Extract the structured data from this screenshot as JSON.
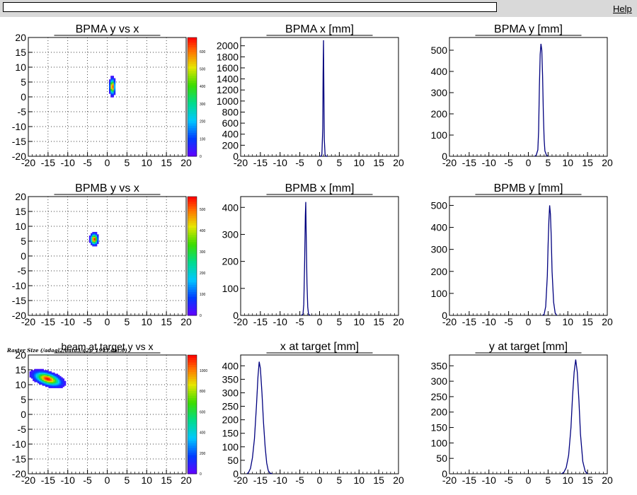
{
  "window": {
    "help_label": "Help",
    "canvas_caption": "Raster Size (/adaql2/data3/g2p_1943.dat.0)"
  },
  "colors": {
    "histogram_line": "#00007f",
    "background": "#ffffff",
    "grid": "#000000"
  },
  "chart_data": [
    {
      "type": "heatmap",
      "title": "BPMA y vs x",
      "xlim": [
        -20,
        20
      ],
      "ylim": [
        -20,
        20
      ],
      "xticks": [
        "-20",
        "-15",
        "-10",
        "-5",
        "0",
        "5",
        "10",
        "15",
        "20"
      ],
      "yticks": [
        "20",
        "15",
        "10",
        "5",
        "0",
        "-5",
        "-10",
        "-15",
        "-20"
      ],
      "grid": true,
      "hotspot": {
        "x": 1.1,
        "y": 3.3,
        "sx": 0.35,
        "sy": 1.4,
        "peak": 680
      },
      "palette_ticks": [
        "600",
        "500",
        "400",
        "300",
        "200",
        "100",
        "0"
      ],
      "zmax": 680
    },
    {
      "type": "histogram",
      "title": "BPMA x [mm]",
      "xlim": [
        -20,
        20
      ],
      "ylim": [
        0,
        2150
      ],
      "xticks": [
        "-20",
        "-15",
        "-10",
        "-5",
        "0",
        "5",
        "10",
        "15",
        "20"
      ],
      "yticks": [
        "2000",
        "1800",
        "1600",
        "1400",
        "1200",
        "1000",
        "800",
        "600",
        "400",
        "200",
        "0"
      ],
      "ytick_values": [
        2000,
        1800,
        1600,
        1400,
        1200,
        1000,
        800,
        600,
        400,
        200,
        0
      ],
      "x": [
        0.0,
        0.4,
        0.6,
        0.8,
        0.9,
        1.0,
        1.1,
        1.2,
        1.4,
        1.6,
        2.0
      ],
      "y": [
        0,
        0,
        40,
        500,
        1500,
        2100,
        1200,
        300,
        30,
        0,
        0
      ]
    },
    {
      "type": "histogram",
      "title": "BPMA y [mm]",
      "xlim": [
        -20,
        20
      ],
      "ylim": [
        0,
        560
      ],
      "xticks": [
        "-20",
        "-15",
        "-10",
        "-5",
        "0",
        "5",
        "10",
        "15",
        "20"
      ],
      "yticks": [
        "500",
        "400",
        "300",
        "200",
        "100",
        "0"
      ],
      "ytick_values": [
        500,
        400,
        300,
        200,
        100,
        0
      ],
      "x": [
        1.6,
        2.0,
        2.4,
        2.6,
        2.8,
        3.0,
        3.2,
        3.4,
        3.6,
        3.8,
        4.0,
        4.2,
        4.6,
        5.0
      ],
      "y": [
        0,
        5,
        30,
        120,
        330,
        480,
        530,
        500,
        380,
        200,
        80,
        25,
        5,
        0
      ]
    },
    {
      "type": "heatmap",
      "title": "BPMB y vs x",
      "xlim": [
        -20,
        20
      ],
      "ylim": [
        -20,
        20
      ],
      "xticks": [
        "-20",
        "-15",
        "-10",
        "-5",
        "0",
        "5",
        "10",
        "15",
        "20"
      ],
      "yticks": [
        "20",
        "15",
        "10",
        "5",
        "0",
        "-5",
        "-10",
        "-15",
        "-20"
      ],
      "grid": true,
      "hotspot": {
        "x": -3.5,
        "y": 5.5,
        "sx": 0.5,
        "sy": 1.0,
        "peak": 560
      },
      "palette_ticks": [
        "500",
        "400",
        "300",
        "200",
        "100",
        "0"
      ],
      "zmax": 560
    },
    {
      "type": "histogram",
      "title": "BPMB x [mm]",
      "xlim": [
        -20,
        20
      ],
      "ylim": [
        0,
        440
      ],
      "xticks": [
        "-20",
        "-15",
        "-10",
        "-5",
        "0",
        "5",
        "10",
        "15",
        "20"
      ],
      "yticks": [
        "400",
        "300",
        "200",
        "100",
        "0"
      ],
      "ytick_values": [
        400,
        300,
        200,
        100,
        0
      ],
      "x": [
        -4.6,
        -4.2,
        -4.0,
        -3.8,
        -3.6,
        -3.5,
        -3.4,
        -3.2,
        -3.0,
        -2.8,
        -2.4
      ],
      "y": [
        0,
        5,
        40,
        180,
        370,
        420,
        320,
        120,
        30,
        5,
        0
      ]
    },
    {
      "type": "histogram",
      "title": "BPMB y [mm]",
      "xlim": [
        -20,
        20
      ],
      "ylim": [
        0,
        540
      ],
      "xticks": [
        "-20",
        "-15",
        "-10",
        "-5",
        "0",
        "5",
        "10",
        "15",
        "20"
      ],
      "yticks": [
        "500",
        "400",
        "300",
        "200",
        "100",
        "0"
      ],
      "ytick_values": [
        500,
        400,
        300,
        200,
        100,
        0
      ],
      "x": [
        3.6,
        4.0,
        4.4,
        4.8,
        5.0,
        5.2,
        5.4,
        5.6,
        5.8,
        6.0,
        6.4,
        6.8,
        7.2
      ],
      "y": [
        0,
        5,
        40,
        180,
        320,
        430,
        500,
        460,
        360,
        200,
        60,
        10,
        0
      ]
    },
    {
      "type": "heatmap",
      "title": "beam at target y vs x",
      "xlim": [
        -20,
        20
      ],
      "ylim": [
        -20,
        20
      ],
      "xticks": [
        "-20",
        "-15",
        "-10",
        "-5",
        "0",
        "5",
        "10",
        "15",
        "20"
      ],
      "yticks": [
        "20",
        "15",
        "10",
        "5",
        "0",
        "-5",
        "-10",
        "-15",
        "-20"
      ],
      "grid": true,
      "hotspot": {
        "x": -15.3,
        "y": 11.8,
        "sx": 1.6,
        "sy": 1.1,
        "peak": 1150,
        "tilt": -0.5
      },
      "palette_ticks": [
        "1000",
        "800",
        "600",
        "400",
        "200",
        "0"
      ],
      "zmax": 1150
    },
    {
      "type": "histogram",
      "title": "x at target [mm]",
      "xlim": [
        -20,
        20
      ],
      "ylim": [
        0,
        440
      ],
      "xticks": [
        "-20",
        "-15",
        "-10",
        "-5",
        "0",
        "5",
        "10",
        "15",
        "20"
      ],
      "yticks": [
        "400",
        "350",
        "300",
        "250",
        "200",
        "150",
        "100",
        "50",
        "0"
      ],
      "ytick_values": [
        400,
        350,
        300,
        250,
        200,
        150,
        100,
        50,
        0
      ],
      "x": [
        -18.4,
        -18.0,
        -17.5,
        -17.0,
        -16.5,
        -16.0,
        -15.6,
        -15.3,
        -15.0,
        -14.6,
        -14.2,
        -13.8,
        -13.4,
        -13.0,
        -12.6,
        -12.0
      ],
      "y": [
        0,
        5,
        20,
        60,
        130,
        250,
        360,
        415,
        390,
        300,
        190,
        100,
        40,
        12,
        3,
        0
      ]
    },
    {
      "type": "histogram",
      "title": "y at target [mm]",
      "xlim": [
        -20,
        20
      ],
      "ylim": [
        0,
        385
      ],
      "xticks": [
        "-20",
        "-15",
        "-10",
        "-5",
        "0",
        "5",
        "10",
        "15",
        "20"
      ],
      "yticks": [
        "350",
        "300",
        "250",
        "200",
        "150",
        "100",
        "50",
        "0"
      ],
      "ytick_values": [
        350,
        300,
        250,
        200,
        150,
        100,
        50,
        0
      ],
      "x": [
        8.4,
        9.0,
        9.6,
        10.2,
        10.8,
        11.2,
        11.6,
        12.0,
        12.4,
        12.8,
        13.2,
        13.8,
        14.4,
        15.0
      ],
      "y": [
        0,
        5,
        20,
        60,
        150,
        250,
        330,
        370,
        330,
        240,
        130,
        40,
        8,
        0
      ]
    }
  ]
}
